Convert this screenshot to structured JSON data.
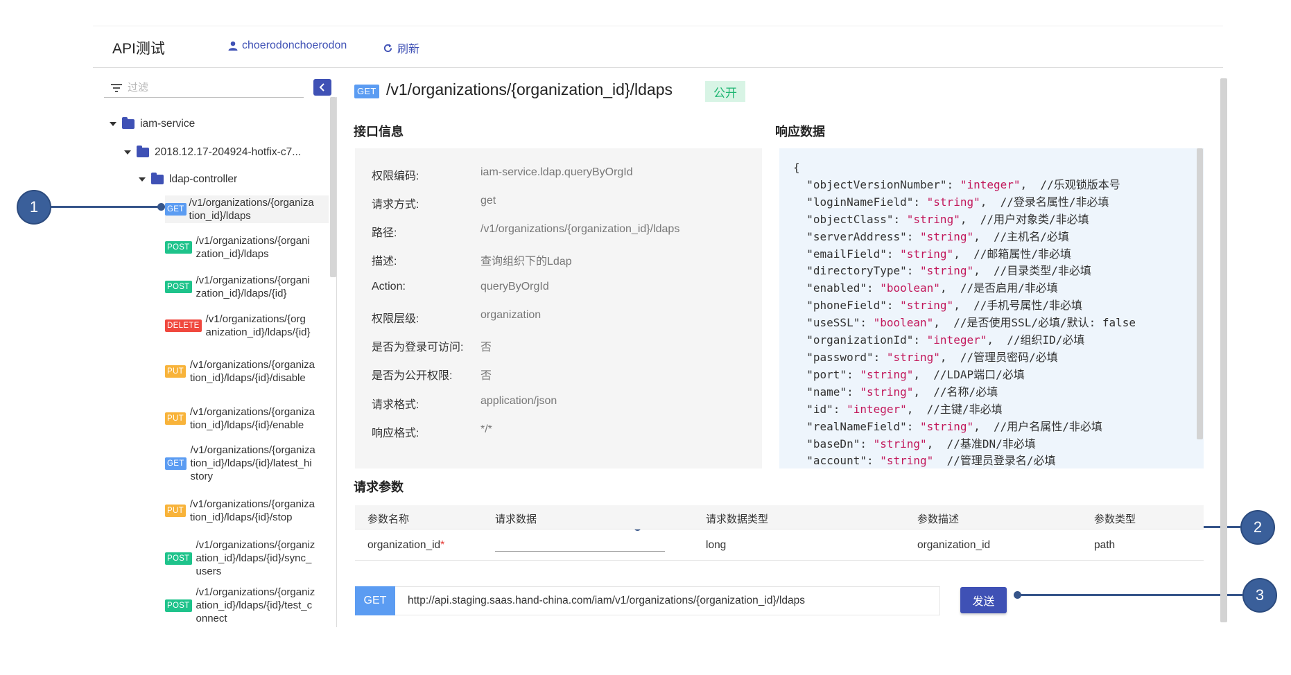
{
  "header": {
    "title": "API测试",
    "user": "choerodonchoerodon",
    "refresh": "刷新"
  },
  "sidebar": {
    "filter_placeholder": "过滤",
    "service": "iam-service",
    "version": "2018.12.17-204924-hotfix-c7...",
    "controller": "ldap-controller",
    "items": [
      {
        "method": "GET",
        "path": "/v1/organizations/{organiza\ntion_id}/ldaps"
      },
      {
        "method": "POST",
        "path": "/v1/organizations/{organi\nzation_id}/ldaps"
      },
      {
        "method": "POST",
        "path": "/v1/organizations/{organi\nzation_id}/ldaps/{id}"
      },
      {
        "method": "DELETE",
        "path": "/v1/organizations/{org\nanization_id}/ldaps/{id}"
      },
      {
        "method": "PUT",
        "path": "/v1/organizations/{organiza\ntion_id}/ldaps/{id}/disable"
      },
      {
        "method": "PUT",
        "path": "/v1/organizations/{organiza\ntion_id}/ldaps/{id}/enable"
      },
      {
        "method": "GET",
        "path": "/v1/organizations/{organiza\ntion_id}/ldaps/{id}/latest_hi\nstory"
      },
      {
        "method": "PUT",
        "path": "/v1/organizations/{organiza\ntion_id}/ldaps/{id}/stop"
      },
      {
        "method": "POST",
        "path": "/v1/organizations/{organiz\nation_id}/ldaps/{id}/sync_\nusers"
      },
      {
        "method": "POST",
        "path": "/v1/organizations/{organiz\nation_id}/ldaps/{id}/test_c\nonnect"
      }
    ]
  },
  "callouts": [
    "1",
    "2",
    "3"
  ],
  "main": {
    "method": "GET",
    "title": "/v1/organizations/{organization_id}/ldaps",
    "tag": "公开",
    "info_title": "接口信息",
    "response_title": "响应数据",
    "params_title": "请求参数",
    "info": [
      {
        "k": "权限编码:",
        "v": "iam-service.ldap.queryByOrgId"
      },
      {
        "k": "请求方式:",
        "v": "get"
      },
      {
        "k": "路径:",
        "v": "/v1/organizations/{organization_id}/ldaps"
      },
      {
        "k": "描述:",
        "v": "查询组织下的Ldap"
      },
      {
        "k": "Action:",
        "v": "queryByOrgId"
      },
      {
        "k": "权限层级:",
        "v": "organization"
      },
      {
        "k": "是否为登录可访问:",
        "v": "否"
      },
      {
        "k": "是否为公开权限:",
        "v": "否"
      },
      {
        "k": "请求格式:",
        "v": "application/json"
      },
      {
        "k": "响应格式:",
        "v": "*/*"
      }
    ],
    "response_open": "{",
    "response": [
      {
        "key": "\"objectVersionNumber\"",
        "type": "\"integer\"",
        "comment": "//乐观锁版本号"
      },
      {
        "key": "\"loginNameField\"",
        "type": "\"string\"",
        "comment": "//登录名属性/非必填"
      },
      {
        "key": "\"objectClass\"",
        "type": "\"string\"",
        "comment": "//用户对象类/非必填"
      },
      {
        "key": "\"serverAddress\"",
        "type": "\"string\"",
        "comment": "//主机名/必填"
      },
      {
        "key": "\"emailField\"",
        "type": "\"string\"",
        "comment": "//邮箱属性/非必填"
      },
      {
        "key": "\"directoryType\"",
        "type": "\"string\"",
        "comment": "//目录类型/非必填"
      },
      {
        "key": "\"enabled\"",
        "type": "\"boolean\"",
        "comment": "//是否启用/非必填"
      },
      {
        "key": "\"phoneField\"",
        "type": "\"string\"",
        "comment": "//手机号属性/非必填"
      },
      {
        "key": "\"useSSL\"",
        "type": "\"boolean\"",
        "comment": "//是否使用SSL/必填/默认: false"
      },
      {
        "key": "\"organizationId\"",
        "type": "\"integer\"",
        "comment": "//组织ID/必填"
      },
      {
        "key": "\"password\"",
        "type": "\"string\"",
        "comment": "//管理员密码/必填"
      },
      {
        "key": "\"port\"",
        "type": "\"string\"",
        "comment": "//LDAP端口/必填"
      },
      {
        "key": "\"name\"",
        "type": "\"string\"",
        "comment": "//名称/必填"
      },
      {
        "key": "\"id\"",
        "type": "\"integer\"",
        "comment": "//主键/非必填"
      },
      {
        "key": "\"realNameField\"",
        "type": "\"string\"",
        "comment": "//用户名属性/非必填"
      },
      {
        "key": "\"baseDn\"",
        "type": "\"string\"",
        "comment": "//基准DN/非必填"
      },
      {
        "key": "\"account\"",
        "type": "\"string\"",
        "comment": "//管理员登录名/必填"
      }
    ],
    "params_headers": [
      "参数名称",
      "请求数据",
      "请求数据类型",
      "参数描述",
      "参数类型"
    ],
    "param_row": {
      "name": "organization_id",
      "required_mark": "*",
      "type": "long",
      "desc": "organization_id",
      "ptype": "path"
    },
    "url_method": "GET",
    "url": "http://api.staging.saas.hand-china.com/iam/v1/organizations/{organization_id}/ldaps",
    "send": "发送"
  },
  "colors": {
    "accent": "#3f51b5",
    "get": "#5b9cf2",
    "post": "#1ec38b",
    "delete": "#f0483e",
    "put": "#f8b33a",
    "callout": "#3a5f9a"
  }
}
